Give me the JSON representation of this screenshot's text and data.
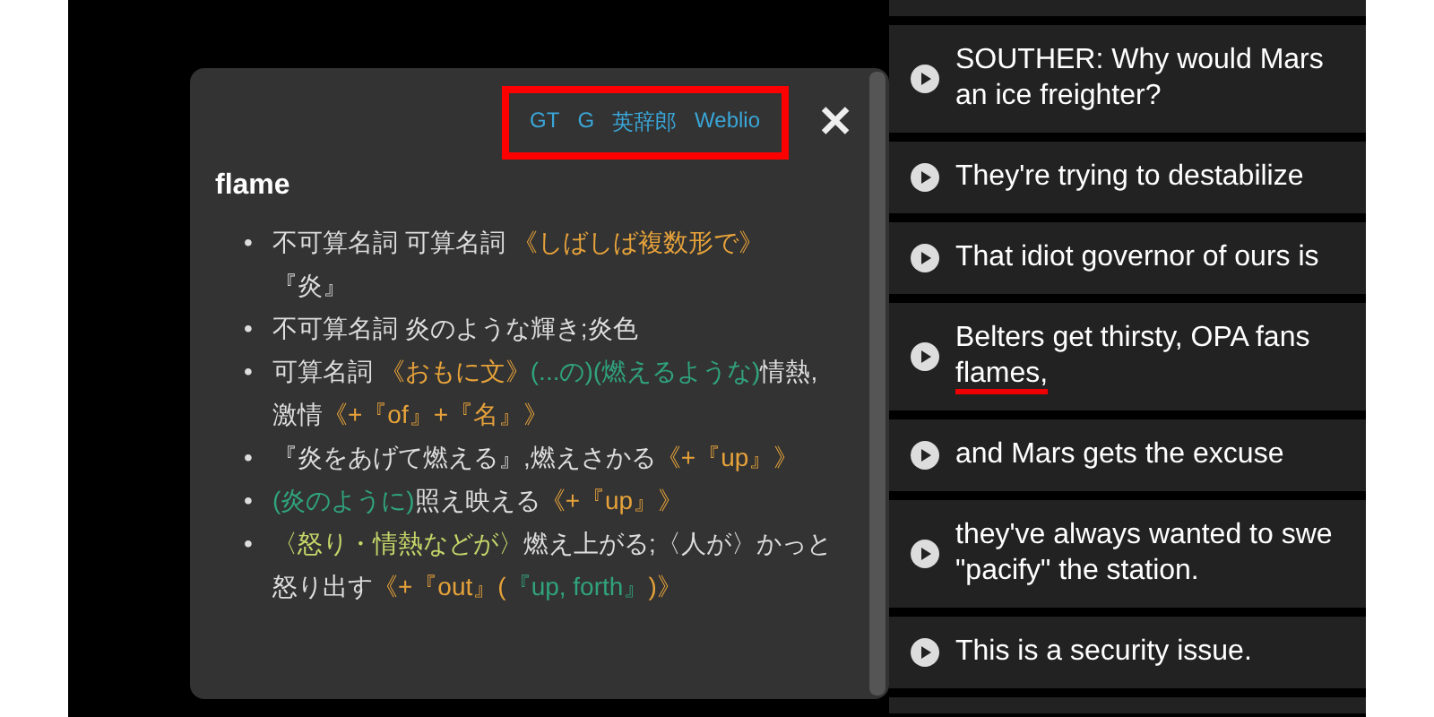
{
  "popup": {
    "links": [
      {
        "label": "GT"
      },
      {
        "label": "G"
      },
      {
        "label": "英辞郎"
      },
      {
        "label": "Weblio"
      }
    ],
    "links_highlighted": true,
    "close": "✕",
    "word": "flame",
    "bullet": "•",
    "definitions": [
      {
        "segments": [
          {
            "kind": "plain",
            "text": "不可算名詞 可算名詞 "
          },
          {
            "kind": "label",
            "text": "《しばしば複数形で》"
          },
          {
            "kind": "plain",
            "text": "『炎』"
          }
        ]
      },
      {
        "segments": [
          {
            "kind": "plain",
            "text": "不可算名詞 炎のような輝き;炎色"
          }
        ]
      },
      {
        "segments": [
          {
            "kind": "plain",
            "text": "可算名詞 "
          },
          {
            "kind": "label",
            "text": "《おもに文》"
          },
          {
            "kind": "note",
            "text": "(...の)(燃えるような)"
          },
          {
            "kind": "plain",
            "text": "情熱,激情"
          },
          {
            "kind": "label",
            "text": "《+『of』+『名』》"
          }
        ]
      },
      {
        "segments": [
          {
            "kind": "plain",
            "text": "『炎をあげて燃える』,燃えさかる"
          },
          {
            "kind": "label",
            "text": "《+『up』》"
          }
        ]
      },
      {
        "segments": [
          {
            "kind": "note",
            "text": "(炎のように)"
          },
          {
            "kind": "plain",
            "text": "照え映える"
          },
          {
            "kind": "label",
            "text": "《+『up』》"
          }
        ]
      },
      {
        "segments": [
          {
            "kind": "subject",
            "text": "〈怒り・情熱などが〉"
          },
          {
            "kind": "plain",
            "text": "燃え上がる;〈人が〉かっと怒り出す"
          },
          {
            "kind": "label",
            "text": "《+『out』("
          },
          {
            "kind": "note",
            "text": "『up, forth』"
          },
          {
            "kind": "label",
            "text": ")》"
          }
        ]
      }
    ]
  },
  "subtitles": [
    {
      "lines": [
        "SOUTHER: Why would Mars",
        "an ice freighter?"
      ],
      "underlined": false
    },
    {
      "lines": [
        "They're trying to destabilize"
      ],
      "underlined": false
    },
    {
      "lines": [
        "That idiot governor of ours is"
      ],
      "underlined": false
    },
    {
      "lines": [
        "Belters get thirsty, OPA fans",
        "flames,"
      ],
      "underlined": true
    },
    {
      "lines": [
        "and Mars gets the excuse"
      ],
      "underlined": false
    },
    {
      "lines": [
        "they've always wanted to swe",
        "\"pacify\" the station."
      ],
      "underlined": false
    },
    {
      "lines": [
        "This is a security issue."
      ],
      "underlined": false
    }
  ]
}
